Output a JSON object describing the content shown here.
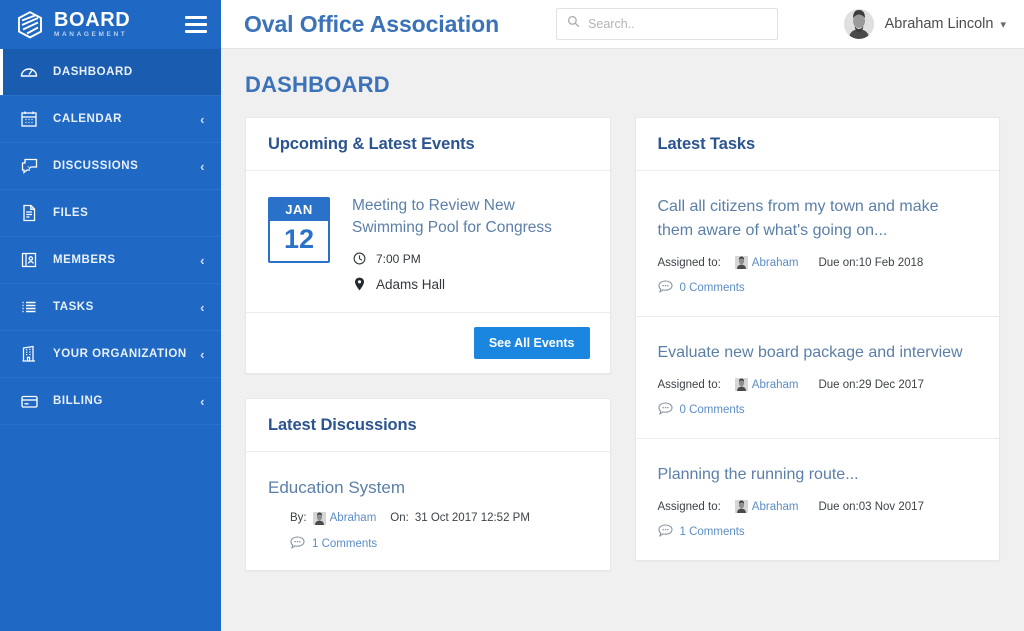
{
  "brand": {
    "name": "BOARD",
    "sub": "MANAGEMENT",
    "logo_icon": "hexagon-stripes-icon",
    "menu_icon": "hamburger-icon"
  },
  "sidebar": {
    "items": [
      {
        "label": "DASHBOARD",
        "icon": "speedometer-icon",
        "active": true,
        "chevron": ""
      },
      {
        "label": "CALENDAR",
        "icon": "calendar-icon",
        "active": false,
        "chevron": "‹"
      },
      {
        "label": "DISCUSSIONS",
        "icon": "chat-bubbles-icon",
        "active": false,
        "chevron": "‹"
      },
      {
        "label": "FILES",
        "icon": "file-icon",
        "active": false,
        "chevron": ""
      },
      {
        "label": "MEMBERS",
        "icon": "id-card-icon",
        "active": false,
        "chevron": "‹"
      },
      {
        "label": "TASKS",
        "icon": "list-icon",
        "active": false,
        "chevron": "‹"
      },
      {
        "label": "YOUR ORGANIZATION",
        "icon": "building-icon",
        "active": false,
        "chevron": "‹"
      },
      {
        "label": "BILLING",
        "icon": "credit-card-icon",
        "active": false,
        "chevron": "‹"
      }
    ]
  },
  "topbar": {
    "org_title": "Oval Office Association",
    "search": {
      "placeholder": "Search..",
      "value": "",
      "icon": "search-icon"
    },
    "user": {
      "name": "Abraham Lincoln",
      "avatar": "user-avatar",
      "caret_icon": "chevron-down-icon"
    }
  },
  "page": {
    "title": "DASHBOARD"
  },
  "events_card": {
    "title": "Upcoming & Latest Events",
    "event": {
      "month": "JAN",
      "day": "12",
      "title": "Meeting to Review New Swimming Pool for Congress",
      "time": "7:00 PM",
      "time_icon": "clock-icon",
      "location": "Adams Hall",
      "location_icon": "map-pin-icon"
    },
    "see_all_label": "See All Events"
  },
  "discussions_card": {
    "title": "Latest Discussions",
    "items": [
      {
        "title": "Education System",
        "by_label": "By:",
        "author": "Abraham",
        "on_label": "On:",
        "date": "31 Oct 2017 12:52 PM",
        "comments": "1 Comments",
        "comments_icon": "comment-bubble-icon"
      }
    ]
  },
  "tasks_card": {
    "title": "Latest Tasks",
    "assigned_label": "Assigned to:",
    "due_label": "Due on:",
    "items": [
      {
        "title": "Call all citizens from my town and make them aware of what's going on...",
        "assignee": "Abraham",
        "due": "10 Feb 2018",
        "comments": "0 Comments",
        "comments_icon": "comment-bubble-icon"
      },
      {
        "title": "Evaluate new board package and interview",
        "assignee": "Abraham",
        "due": "29 Dec 2017",
        "comments": "0 Comments",
        "comments_icon": "comment-bubble-icon"
      },
      {
        "title": "Planning the running route...",
        "assignee": "Abraham",
        "due": "03 Nov 2017",
        "comments": "1 Comments",
        "comments_icon": "comment-bubble-icon"
      }
    ]
  },
  "colors": {
    "sidebar_blue": "#1f68c4",
    "sidebar_active": "#1a5cb0",
    "accent_blue": "#2a71c9",
    "button_blue": "#1a86e0",
    "title_blue": "#3b72b8",
    "card_title": "#2b5490",
    "link_blue": "#5b7fa8",
    "page_bg": "#f0f0f0"
  }
}
